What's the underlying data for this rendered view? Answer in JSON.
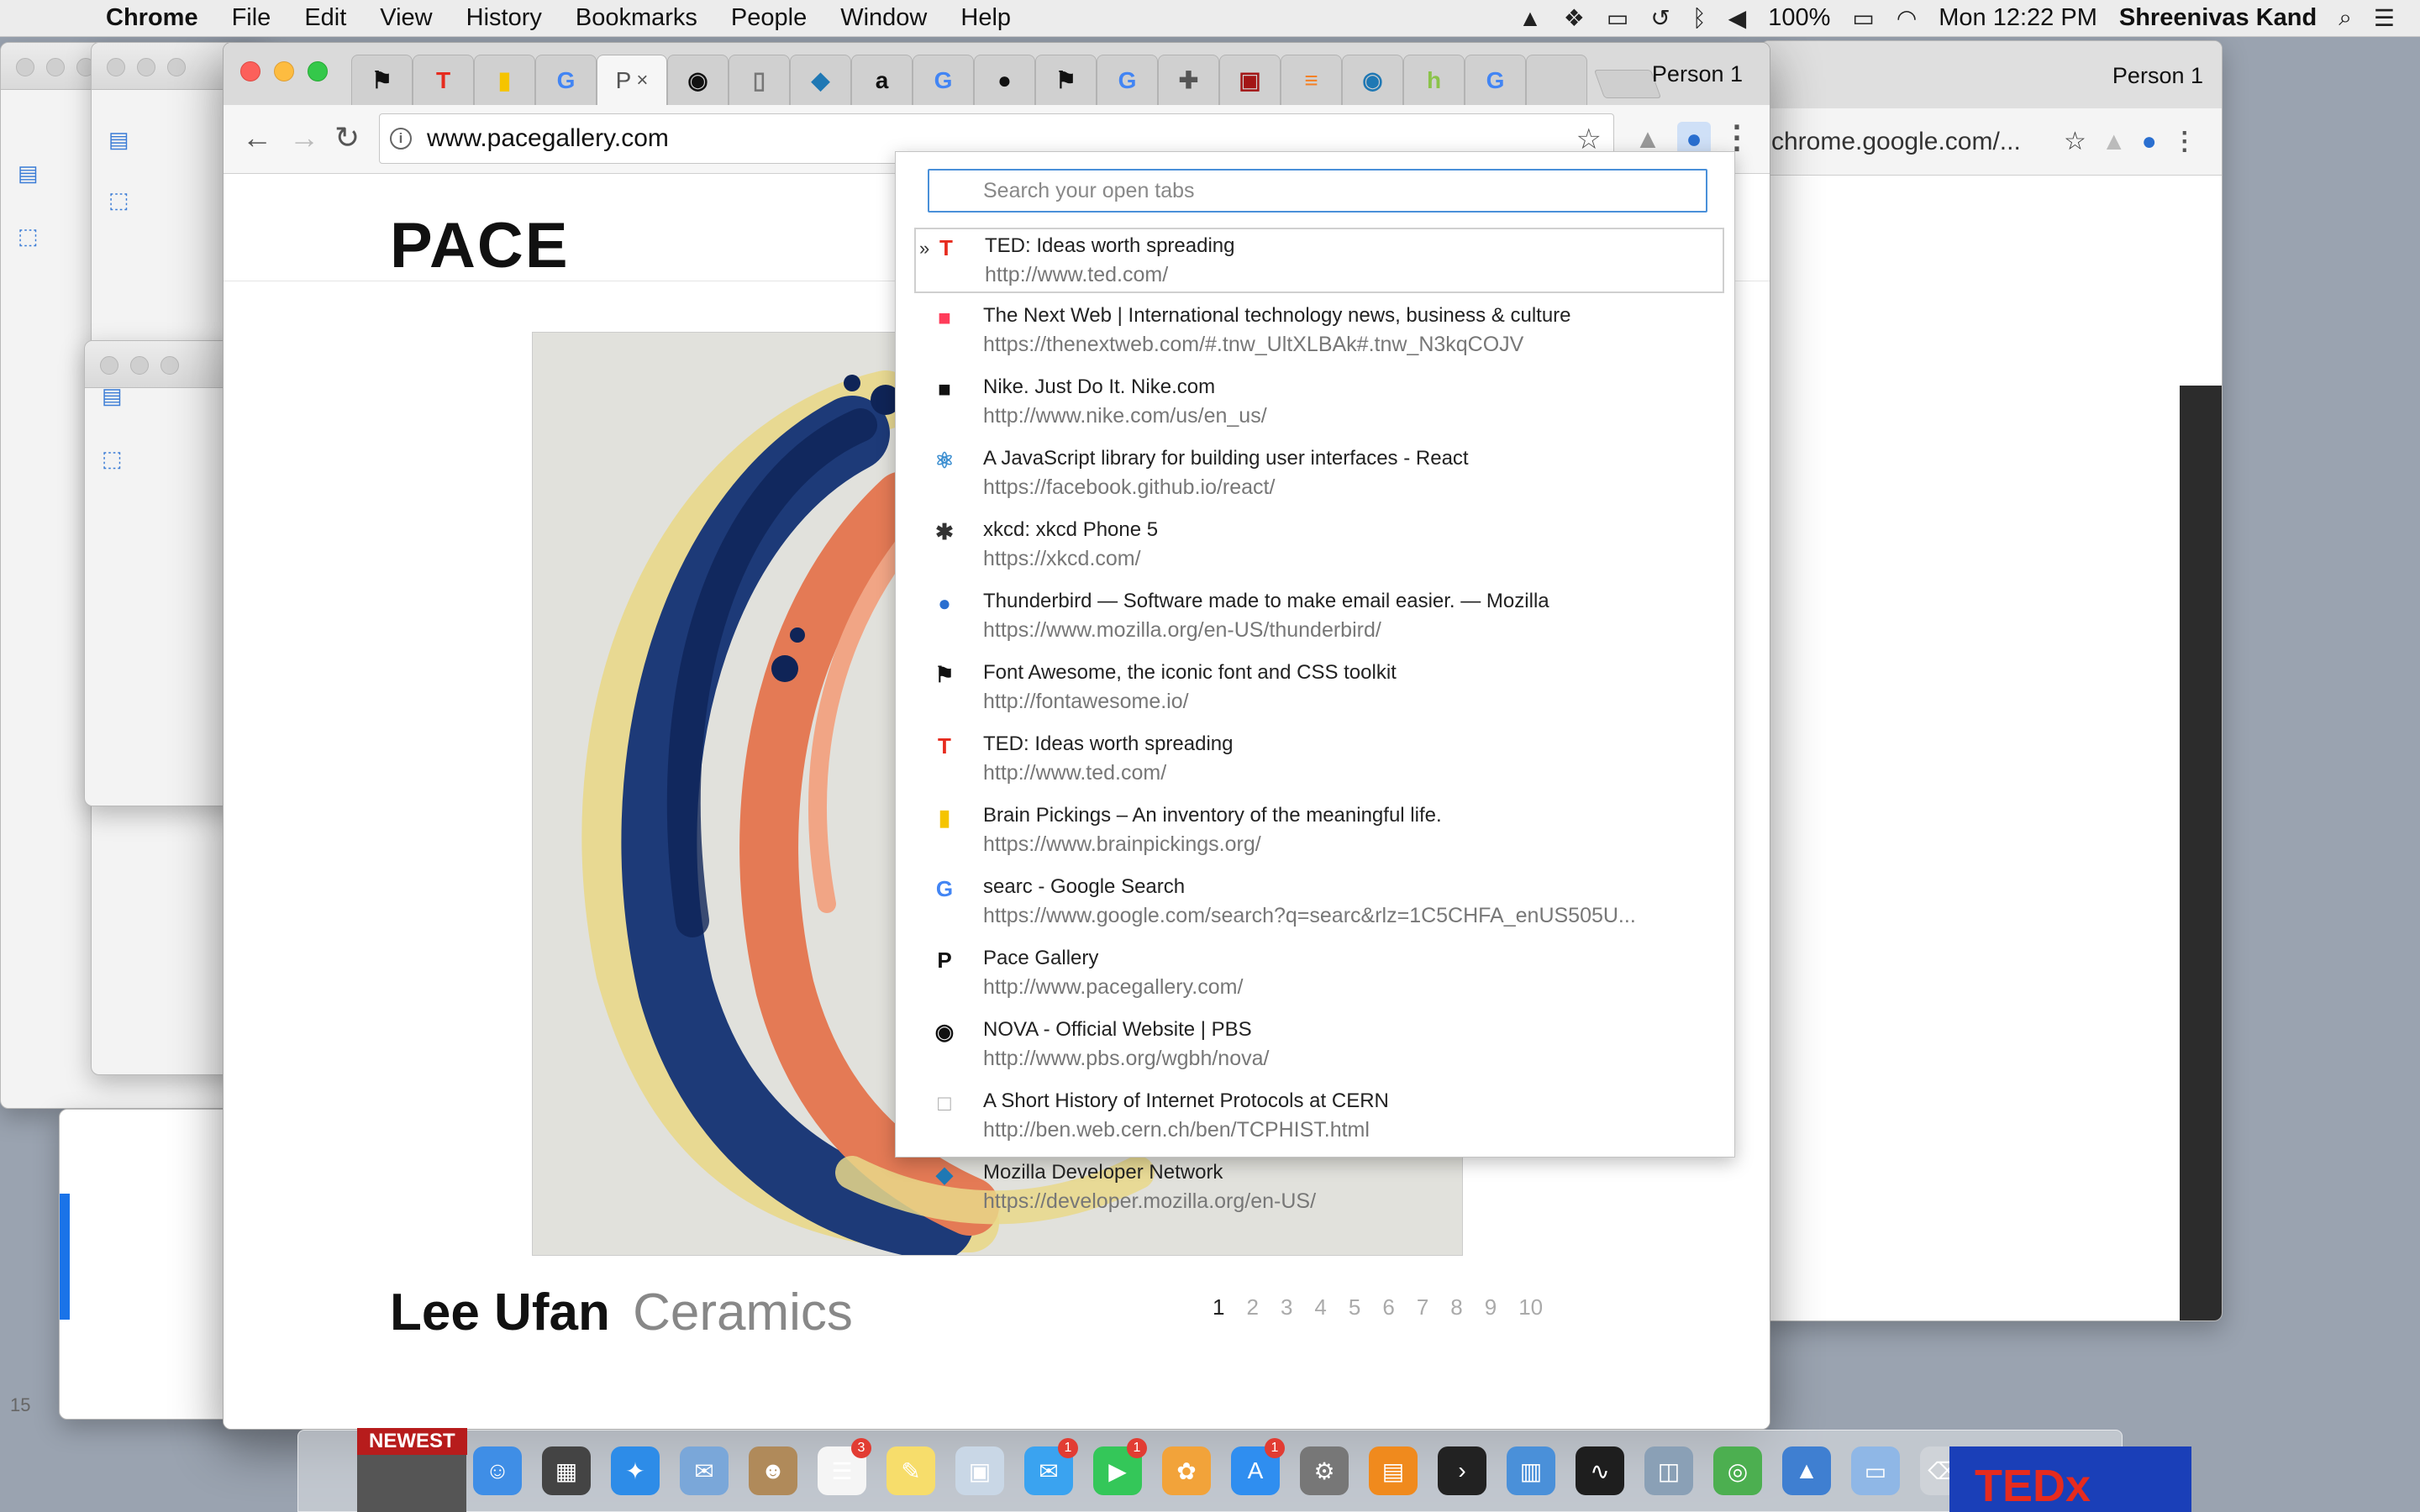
{
  "menubar": {
    "app": "Chrome",
    "items": [
      "File",
      "Edit",
      "View",
      "History",
      "Bookmarks",
      "People",
      "Window",
      "Help"
    ],
    "battery": "100%",
    "clock": "Mon 12:22 PM",
    "user": "Shreenivas Kand"
  },
  "background_window": {
    "person": "Person 1",
    "url": "chrome.google.com/..."
  },
  "browser": {
    "person": "Person 1",
    "active_tab_label": "P",
    "tabs": [
      {
        "icon": "flag-icon",
        "glyph": "⚑",
        "color": "#111111"
      },
      {
        "icon": "ted-icon",
        "glyph": "T",
        "color": "#e62b1e"
      },
      {
        "icon": "brainpickings-icon",
        "glyph": "▮",
        "color": "#f5c400"
      },
      {
        "icon": "google-icon",
        "glyph": "G",
        "color": "#4285f4"
      },
      {
        "icon": "pace-icon",
        "glyph": "P",
        "color": "#111111"
      },
      {
        "icon": "pbs-icon",
        "glyph": "◉",
        "color": "#111111"
      },
      {
        "icon": "document-icon",
        "glyph": "▯",
        "color": "#777777"
      },
      {
        "icon": "mdn-icon",
        "glyph": "◆",
        "color": "#1f78b4"
      },
      {
        "icon": "amazon-icon",
        "glyph": "a",
        "color": "#111111"
      },
      {
        "icon": "google-icon",
        "glyph": "G",
        "color": "#4285f4"
      },
      {
        "icon": "github-icon",
        "glyph": "●",
        "color": "#111111"
      },
      {
        "icon": "flag-icon",
        "glyph": "⚑",
        "color": "#111111"
      },
      {
        "icon": "google-icon",
        "glyph": "G",
        "color": "#4285f4"
      },
      {
        "icon": "puzzle-icon",
        "glyph": "✚",
        "color": "#555555"
      },
      {
        "icon": "orc-icon",
        "glyph": "▣",
        "color": "#a31515"
      },
      {
        "icon": "stackoverflow-icon",
        "glyph": "≡",
        "color": "#f48024"
      },
      {
        "icon": "pbs-icon",
        "glyph": "◉",
        "color": "#1f78b4"
      },
      {
        "icon": "lh-icon",
        "glyph": "h",
        "color": "#8bc34a"
      },
      {
        "icon": "google-icon",
        "glyph": "G",
        "color": "#4285f4"
      },
      {
        "icon": "apple-icon",
        "glyph": "",
        "color": "#888888"
      }
    ],
    "url": "www.pacegallery.com"
  },
  "page": {
    "logo": "PACE",
    "artist": "Lee Ufan",
    "show": "Ceramics",
    "pages": [
      "1",
      "2",
      "3",
      "4",
      "5",
      "6",
      "7",
      "8",
      "9",
      "10"
    ]
  },
  "popup": {
    "search_placeholder": "Search your open tabs",
    "selected_marker": "»",
    "results": [
      {
        "title": "TED: Ideas worth spreading",
        "url": "http://www.ted.com/",
        "icon": "ted-icon",
        "glyph": "T",
        "color": "#e62b1e"
      },
      {
        "title": "The Next Web | International technology news, business & culture",
        "url": "https://thenextweb.com/#.tnw_UltXLBAk#.tnw_N3kqCOJV",
        "icon": "tnw-icon",
        "glyph": "■",
        "color": "#ff3c5a"
      },
      {
        "title": "Nike. Just Do It. Nike.com",
        "url": "http://www.nike.com/us/en_us/",
        "icon": "nike-icon",
        "glyph": "■",
        "color": "#111111"
      },
      {
        "title": "A JavaScript library for building user interfaces - React",
        "url": "https://facebook.github.io/react/",
        "icon": "react-icon",
        "glyph": "⚛",
        "color": "#3b8ed0"
      },
      {
        "title": "xkcd: xkcd Phone 5",
        "url": "https://xkcd.com/",
        "icon": "xkcd-icon",
        "glyph": "✱",
        "color": "#333333"
      },
      {
        "title": "Thunderbird — Software made to make email easier. — Mozilla",
        "url": "https://www.mozilla.org/en-US/thunderbird/",
        "icon": "thunderbird-icon",
        "glyph": "●",
        "color": "#2a6fd0"
      },
      {
        "title": "Font Awesome, the iconic font and CSS toolkit",
        "url": "http://fontawesome.io/",
        "icon": "flag-icon",
        "glyph": "⚑",
        "color": "#111111"
      },
      {
        "title": "TED: Ideas worth spreading",
        "url": "http://www.ted.com/",
        "icon": "ted-icon",
        "glyph": "T",
        "color": "#e62b1e"
      },
      {
        "title": "Brain Pickings – An inventory of the meaningful life.",
        "url": "https://www.brainpickings.org/",
        "icon": "brainpickings-icon",
        "glyph": "▮",
        "color": "#f5c400"
      },
      {
        "title": "searc - Google Search",
        "url": "https://www.google.com/search?q=searc&rlz=1C5CHFA_enUS505U...",
        "icon": "google-icon",
        "glyph": "G",
        "color": "#4285f4"
      },
      {
        "title": "Pace Gallery",
        "url": "http://www.pacegallery.com/",
        "icon": "pace-icon",
        "glyph": "P",
        "color": "#111111"
      },
      {
        "title": "NOVA - Official Website | PBS",
        "url": "http://www.pbs.org/wgbh/nova/",
        "icon": "pbs-icon",
        "glyph": "◉",
        "color": "#111111"
      },
      {
        "title": "A Short History of Internet Protocols at CERN",
        "url": "http://ben.web.cern.ch/ben/TCPHIST.html",
        "icon": "blank-page-icon",
        "glyph": "□",
        "color": "#aaaaaa"
      },
      {
        "title": "Mozilla Developer Network",
        "url": "https://developer.mozilla.org/en-US/",
        "icon": "mdn-icon",
        "glyph": "◆",
        "color": "#1f78b4"
      }
    ]
  },
  "dock": {
    "newest_label": "NEWEST",
    "items": [
      {
        "name": "finder-icon",
        "color": "#3f8ee6",
        "glyph": "☺",
        "badge": ""
      },
      {
        "name": "news-app-icon",
        "color": "#444444",
        "glyph": "▦",
        "badge": ""
      },
      {
        "name": "safari-icon",
        "color": "#2d8ce8",
        "glyph": "✦",
        "badge": ""
      },
      {
        "name": "mail-stamp-icon",
        "color": "#7aa7d9",
        "glyph": "✉",
        "badge": ""
      },
      {
        "name": "contacts-icon",
        "color": "#b08a5a",
        "glyph": "☻",
        "badge": ""
      },
      {
        "name": "reminders-icon",
        "color": "#f5f5f5",
        "glyph": "☰",
        "badge": "3"
      },
      {
        "name": "notes-icon",
        "color": "#f7dd6b",
        "glyph": "✎",
        "badge": ""
      },
      {
        "name": "preview-icon",
        "color": "#c9d7e6",
        "glyph": "▣",
        "badge": ""
      },
      {
        "name": "messages-icon",
        "color": "#3aa3f0",
        "glyph": "✉",
        "badge": "1"
      },
      {
        "name": "facetime-icon",
        "color": "#34c759",
        "glyph": "▶",
        "badge": "1"
      },
      {
        "name": "photos-icon",
        "color": "#f2a33a",
        "glyph": "✿",
        "badge": ""
      },
      {
        "name": "app-store-icon",
        "color": "#2f8ef0",
        "glyph": "A",
        "badge": "1"
      },
      {
        "name": "system-preferences-icon",
        "color": "#777777",
        "glyph": "⚙",
        "badge": ""
      },
      {
        "name": "ibooks-icon",
        "color": "#f08a1d",
        "glyph": "▤",
        "badge": ""
      },
      {
        "name": "terminal-icon",
        "color": "#222222",
        "glyph": "›",
        "badge": ""
      },
      {
        "name": "keynote-chart-icon",
        "color": "#4a90d9",
        "glyph": "▥",
        "badge": ""
      },
      {
        "name": "activity-monitor-icon",
        "color": "#1e1e1e",
        "glyph": "∿",
        "badge": ""
      },
      {
        "name": "image-capture-icon",
        "color": "#8aa0b6",
        "glyph": "◫",
        "badge": ""
      },
      {
        "name": "chrome-icon",
        "color": "#4caf50",
        "glyph": "◎",
        "badge": ""
      },
      {
        "name": "keynote-icon",
        "color": "#3f7fd1",
        "glyph": "▲",
        "badge": ""
      },
      {
        "name": "folder-icon",
        "color": "#8fb7e6",
        "glyph": "▭",
        "badge": ""
      },
      {
        "name": "trash-icon",
        "color": "#cfd3d8",
        "glyph": "⌫",
        "badge": ""
      }
    ]
  },
  "misc": {
    "left_number": "15"
  }
}
